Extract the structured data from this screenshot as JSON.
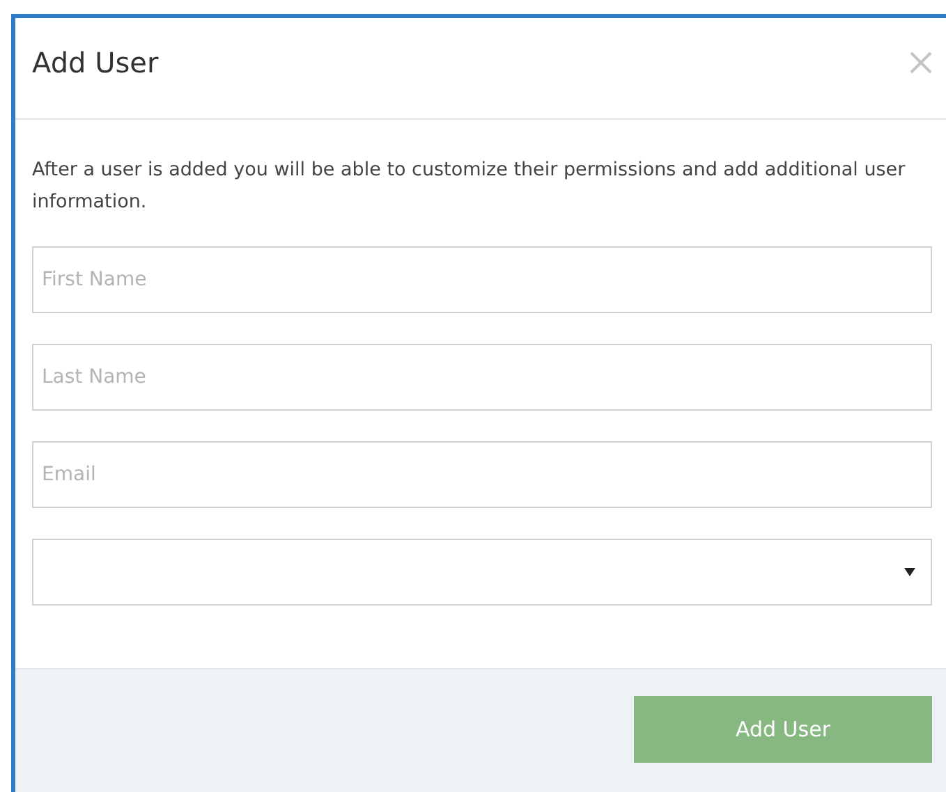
{
  "dialog": {
    "title": "Add User",
    "description": "After a user is added you will be able to customize their permissions and add additional user information.",
    "fields": [
      {
        "kind": "text",
        "placeholder": "First Name"
      },
      {
        "kind": "text",
        "placeholder": "Last Name"
      },
      {
        "kind": "text",
        "placeholder": "Email"
      },
      {
        "kind": "select"
      }
    ],
    "submit_button": "Add User"
  }
}
